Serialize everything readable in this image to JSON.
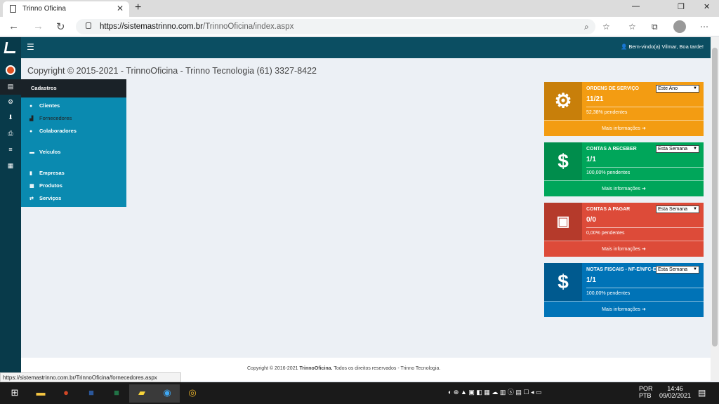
{
  "browser": {
    "tab_title": "Trinno Oficina",
    "tab_close": "✕",
    "new_tab": "+",
    "url_host": "https://sistemastrinno.com.br",
    "url_path": "/TrinnoOficina/index.aspx",
    "status_url": "https://sistemastrinno.com.br/TrinnoOficina/fornecedores.aspx"
  },
  "app": {
    "welcome": "Bem-vindo(a) Vilmar, Boa tarde!",
    "copyright_top": "Copyright © 2015-2021 - TrinnoOficina - Trinno Tecnologia (61) 3327-8422",
    "footer_prefix": "Copyright © 2016-2021 ",
    "footer_brand": "TrinnoOficina.",
    "footer_suffix": " Todos os direitos reservados - Trinno Tecnologia."
  },
  "menu": {
    "header": "Cadastros",
    "items": [
      {
        "label": "Clientes",
        "icon": "user-icon"
      },
      {
        "label": "Fornecedores",
        "icon": "factory-icon"
      },
      {
        "label": "Colaboradores",
        "icon": "users-icon"
      },
      {
        "label": "Veículos",
        "icon": "car-icon"
      },
      {
        "label": "Empresas",
        "icon": "building-icon"
      },
      {
        "label": "Produtos",
        "icon": "grid-icon"
      },
      {
        "label": "Serviços",
        "icon": "exchange-icon"
      }
    ]
  },
  "cards": [
    {
      "title": "ORDENS DE SERVIÇO",
      "select": "Este Ano",
      "value": "11/21",
      "pending": "52,38% pendentes",
      "more": "Mais informações",
      "icon": "gears-icon",
      "color": "#f39c12",
      "dark": "#c87f0a"
    },
    {
      "title": "CONTAS A RECEBER",
      "select": "Esta Semana",
      "value": "1/1",
      "pending": "100,00% pendentes",
      "more": "Mais informações",
      "icon": "dollar-icon",
      "color": "#00a65a",
      "dark": "#008d4c"
    },
    {
      "title": "CONTAS A PAGAR",
      "select": "Esta Semana",
      "value": "0/0",
      "pending": "0,00% pendentes",
      "more": "Mais informações",
      "icon": "money-bill-icon",
      "color": "#dd4b39",
      "dark": "#b53a2b"
    },
    {
      "title": "NOTAS FISCAIS - NF-E/NFC-E",
      "select": "Esta Semana",
      "value": "1/1",
      "pending": "100,00% pendentes",
      "more": "Mais informações",
      "icon": "dollar-icon",
      "color": "#0073b7",
      "dark": "#005a8f"
    }
  ],
  "taskbar": {
    "lang": "POR",
    "lang2": "PTB",
    "time": "14:46",
    "date": "09/02/2021"
  }
}
